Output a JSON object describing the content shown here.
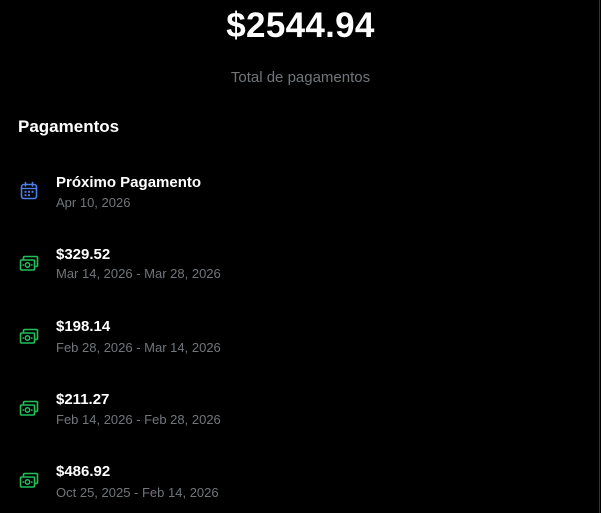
{
  "summary": {
    "total_amount": "$2544.94",
    "total_caption": "Total de pagamentos"
  },
  "section": {
    "title": "Pagamentos"
  },
  "next_payment": {
    "icon": "calendar-icon",
    "label": "Próximo Pagamento",
    "date": "Apr 10, 2026"
  },
  "payments": [
    {
      "icon": "money-icon",
      "amount": "$329.52",
      "period": "Mar 14, 2026 - Mar 28, 2026"
    },
    {
      "icon": "money-icon",
      "amount": "$198.14",
      "period": "Feb 28, 2026 - Mar 14, 2026"
    },
    {
      "icon": "money-icon",
      "amount": "$211.27",
      "period": "Feb 14, 2026 - Feb 28, 2026"
    },
    {
      "icon": "money-icon",
      "amount": "$486.92",
      "period": "Oct 25, 2025 - Feb 14, 2026"
    }
  ],
  "colors": {
    "background": "#000000",
    "text": "#ffffff",
    "muted": "#71767b",
    "calendar_icon": "#4c7ee6",
    "money_icon": "#1fbf59"
  }
}
